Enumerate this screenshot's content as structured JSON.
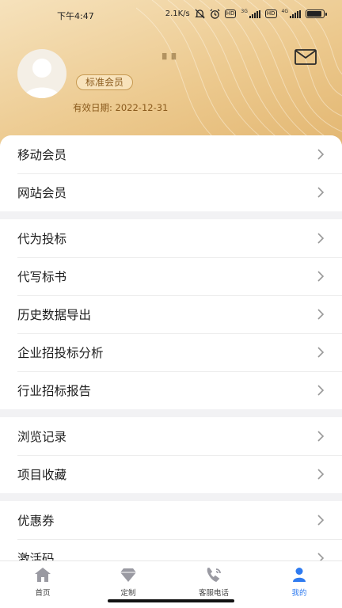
{
  "status": {
    "time": "下午4:47",
    "net_speed": "2.1K/s",
    "hd1": "HD",
    "net1": "3G",
    "hd2": "HD",
    "net2": "4G"
  },
  "profile": {
    "username": "▘▘",
    "member_level": "标准会员",
    "expiry_label": "有效日期:",
    "expiry_date": "2022-12-31"
  },
  "menu": {
    "groups": [
      {
        "items": [
          {
            "label": "移动会员"
          },
          {
            "label": "网站会员"
          }
        ]
      },
      {
        "items": [
          {
            "label": "代为投标"
          },
          {
            "label": "代写标书"
          },
          {
            "label": "历史数据导出"
          },
          {
            "label": "企业招投标分析"
          },
          {
            "label": "行业招标报告"
          }
        ]
      },
      {
        "items": [
          {
            "label": "浏览记录"
          },
          {
            "label": "项目收藏"
          }
        ]
      },
      {
        "items": [
          {
            "label": "优惠券"
          },
          {
            "label": "激活码"
          }
        ]
      }
    ]
  },
  "tabs": [
    {
      "label": "首页",
      "icon": "home-icon"
    },
    {
      "label": "定制",
      "icon": "diamond-icon"
    },
    {
      "label": "客服电话",
      "icon": "phone-icon"
    },
    {
      "label": "我的",
      "icon": "user-icon",
      "active": true
    }
  ],
  "colors": {
    "accent": "#2f7bf0",
    "header_gold": "#e9c489",
    "badge_text": "#8a5a1c"
  }
}
